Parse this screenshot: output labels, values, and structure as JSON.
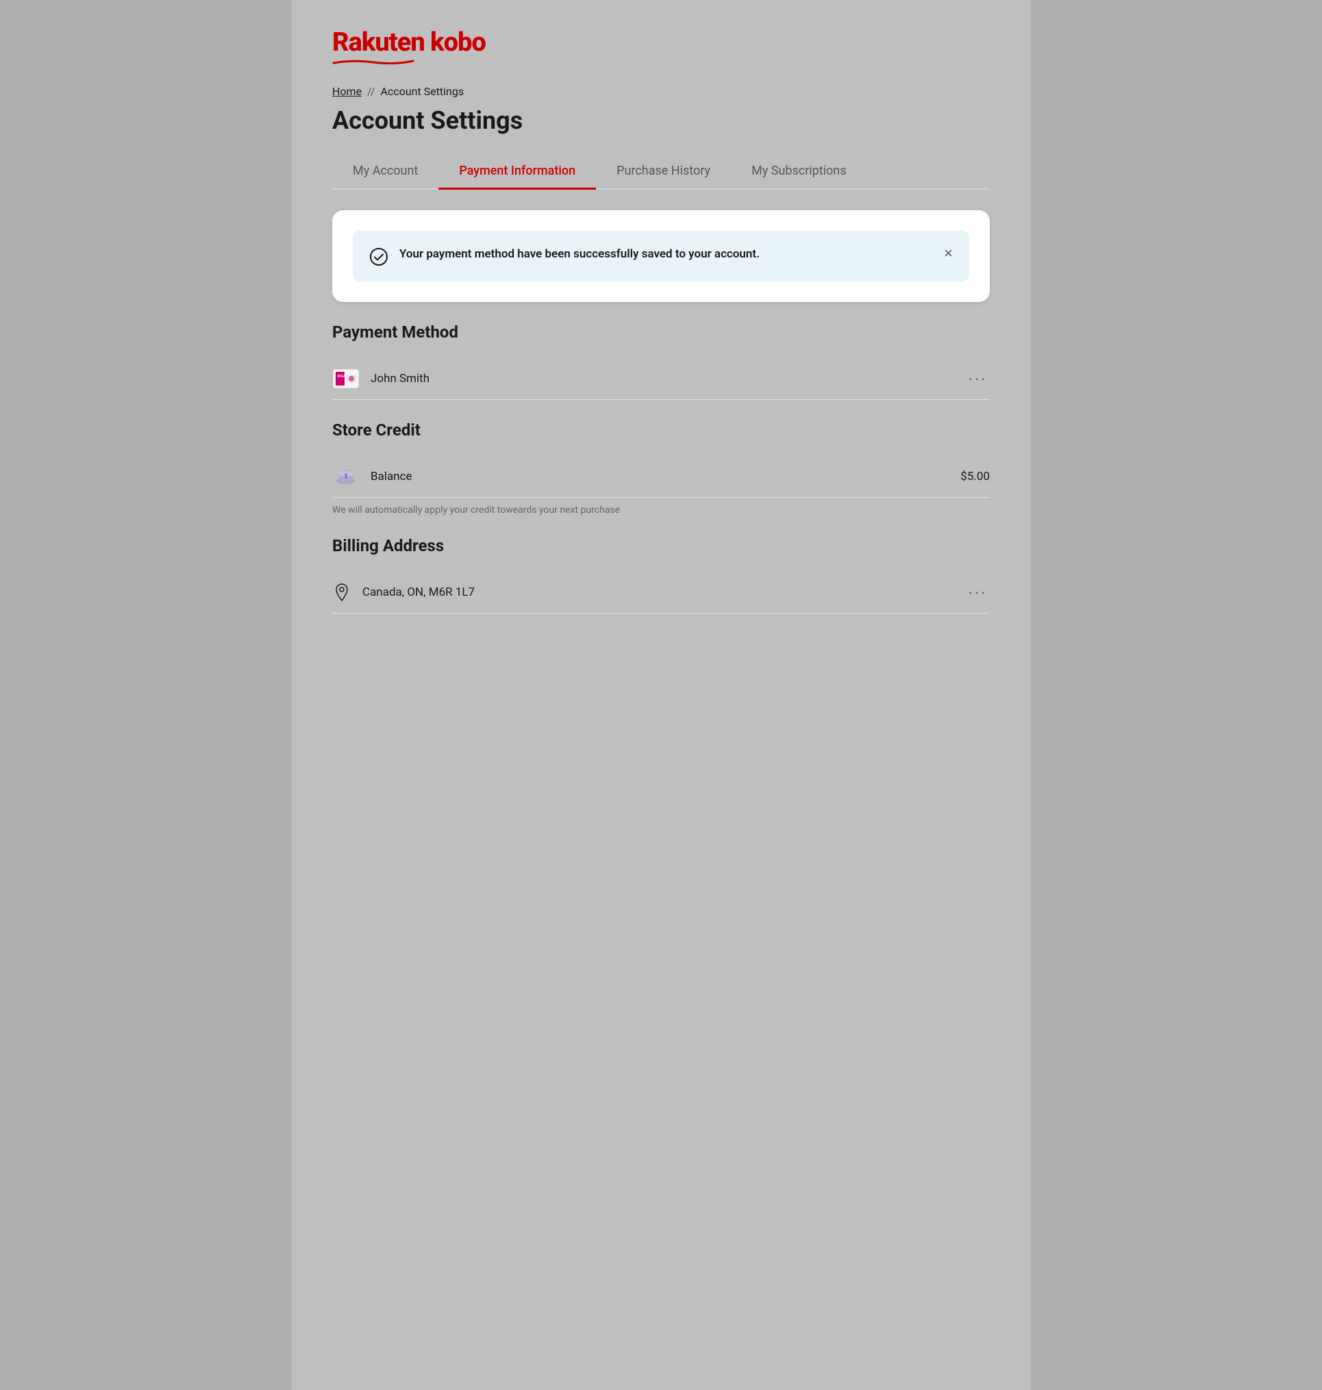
{
  "logo": {
    "text": "Rakuten kobo"
  },
  "breadcrumb": {
    "home": "Home",
    "separator": "//",
    "current": "Account Settings"
  },
  "page_title": "Account Settings",
  "tabs": [
    {
      "id": "my-account",
      "label": "My Account",
      "active": false
    },
    {
      "id": "payment-information",
      "label": "Payment Information",
      "active": true
    },
    {
      "id": "purchase-history",
      "label": "Purchase History",
      "active": false
    },
    {
      "id": "my-subscriptions",
      "label": "My Subscriptions",
      "active": false
    }
  ],
  "success_banner": {
    "message": "Your payment method have been successfully saved to your account."
  },
  "payment_method": {
    "section_title": "Payment Method",
    "items": [
      {
        "name": "John Smith",
        "type": "ideal"
      }
    ]
  },
  "store_credit": {
    "section_title": "Store Credit",
    "balance_label": "Balance",
    "balance_amount": "$5.00",
    "note": "We will automatically apply your credit toweards your next purchase"
  },
  "billing_address": {
    "section_title": "Billing Address",
    "address": "Canada, ON, M6R 1L7"
  },
  "icons": {
    "close": "×",
    "more": "•••",
    "check": "✓"
  }
}
